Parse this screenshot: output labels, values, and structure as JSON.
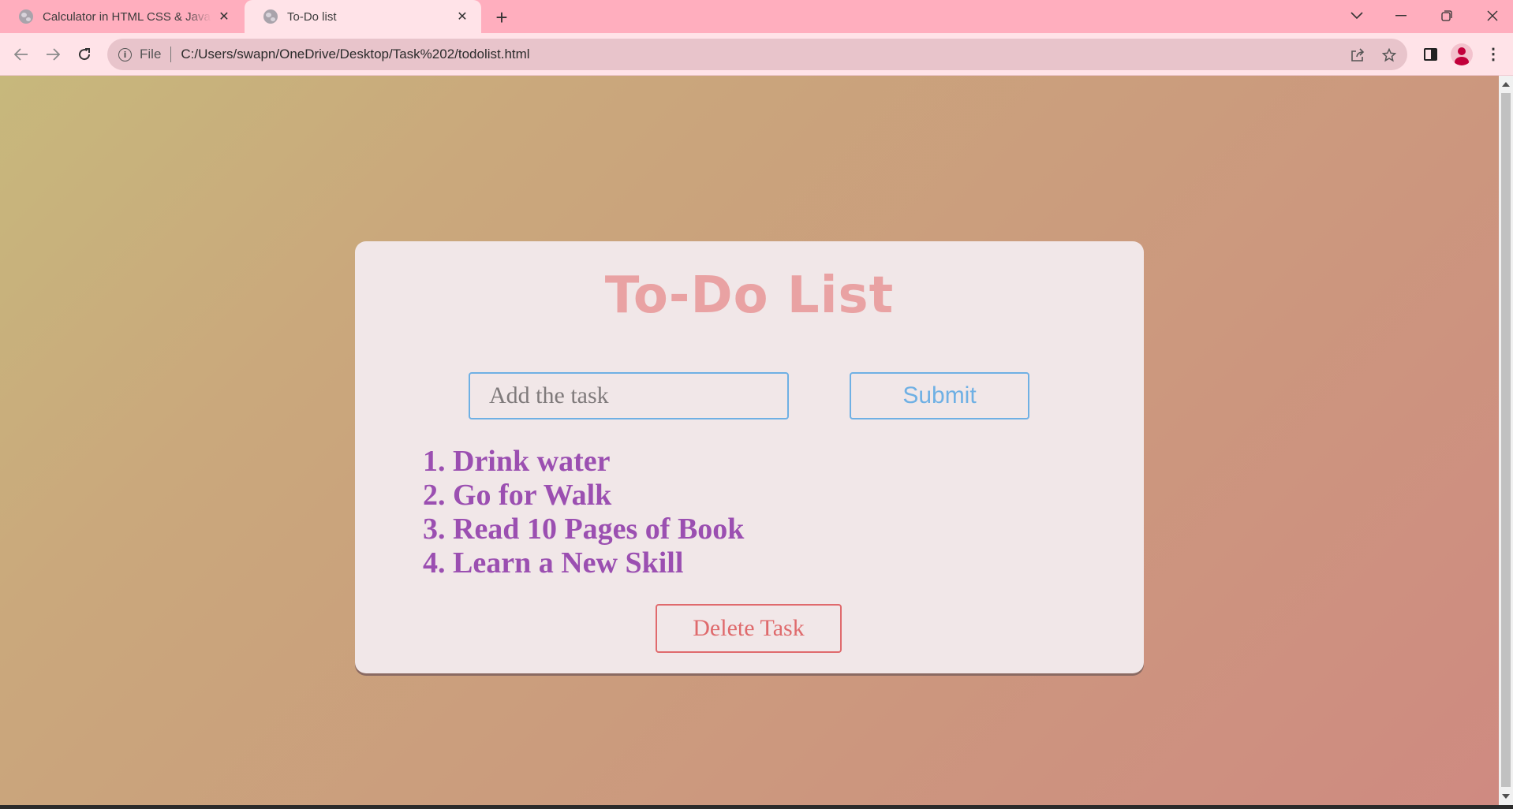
{
  "browser": {
    "tabs": [
      {
        "title": "Calculator in HTML CSS & JavaScript",
        "active": false
      },
      {
        "title": "To-Do list",
        "active": true
      }
    ],
    "address": {
      "scheme": "File",
      "url": "C:/Users/swapn/OneDrive/Desktop/Task%202/todolist.html"
    },
    "icons": {
      "tab_favicon": "globe-icon",
      "tab_close": "close-icon",
      "new_tab": "plus-icon",
      "tab_search": "chevron-down-icon",
      "minimize": "minimize-icon",
      "restore": "restore-icon",
      "close": "close-window-icon",
      "back": "back-arrow-icon",
      "forward": "forward-arrow-icon",
      "reload": "reload-icon",
      "site_info": "info-icon",
      "share": "share-icon",
      "bookmark": "star-icon",
      "side_panel": "side-panel-icon",
      "profile": "profile-avatar-icon",
      "menu": "kebab-menu-icon"
    }
  },
  "page": {
    "title": "To-Do List",
    "input_placeholder": "Add the task",
    "input_value": "",
    "submit_label": "Submit",
    "tasks": [
      {
        "number": "1.",
        "text": "Drink water"
      },
      {
        "number": "2.",
        "text": "Go for Walk"
      },
      {
        "number": "3.",
        "text": "Read 10 Pages of Book"
      },
      {
        "number": "4.",
        "text": "Learn a New Skill"
      }
    ],
    "delete_label": "Delete Task"
  },
  "colors": {
    "tabstrip": "#ffaebe",
    "toolbar": "#ffe3e8",
    "card_background": "#f1e7e8",
    "title": "#e9a2a3",
    "input_border": "#6fb0e4",
    "task_text": "#9b4fb1",
    "delete_button": "#e06a6d"
  }
}
